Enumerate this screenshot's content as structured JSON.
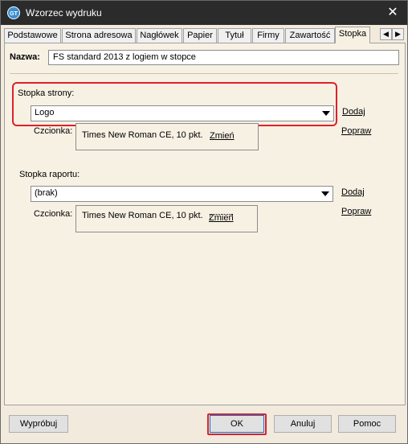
{
  "window": {
    "title": "Wzorzec wydruku"
  },
  "icons": {
    "app": "app-logo-icon",
    "close": "close-icon",
    "tab_left": "arrow-left-icon",
    "tab_right": "arrow-right-icon",
    "dropdown": "chevron-down-icon"
  },
  "tabs": [
    {
      "label": "Podstawowe"
    },
    {
      "label": "Strona adresowa"
    },
    {
      "label": "Nagłówek"
    },
    {
      "label": "Papier"
    },
    {
      "label": "Tytuł"
    },
    {
      "label": "Firmy"
    },
    {
      "label": "Zawartość"
    },
    {
      "label": "Stopka"
    }
  ],
  "active_tab": "Stopka",
  "glyphs": {
    "close": "✕",
    "left": "◀",
    "right": "▶"
  },
  "name_field": {
    "label": "Nazwa:",
    "value": "FS standard 2013 z logiem w stopce"
  },
  "page_footer": {
    "label": "Stopka strony:",
    "selected": "Logo",
    "add_label": "Dodaj",
    "font_label": "Czcionka:",
    "font_value": "Times New Roman CE, 10 pkt.",
    "change_label": "Zmień",
    "edit_label": "Popraw"
  },
  "report_footer": {
    "label": "Stopka raportu:",
    "selected": "(brak)",
    "add_label": "Dodaj",
    "font_label": "Czcionka:",
    "font_value": "Times New Roman CE, 10 pkt.",
    "change_label": "Zmień",
    "edit_label": "Popraw"
  },
  "buttons": {
    "preview": "Wypróbuj",
    "ok": "OK",
    "cancel": "Anuluj",
    "help": "Pomoc"
  },
  "colors": {
    "highlight": "#e0202a",
    "titlebar": "#2b2b2b",
    "panel": "#f7f1e4"
  }
}
